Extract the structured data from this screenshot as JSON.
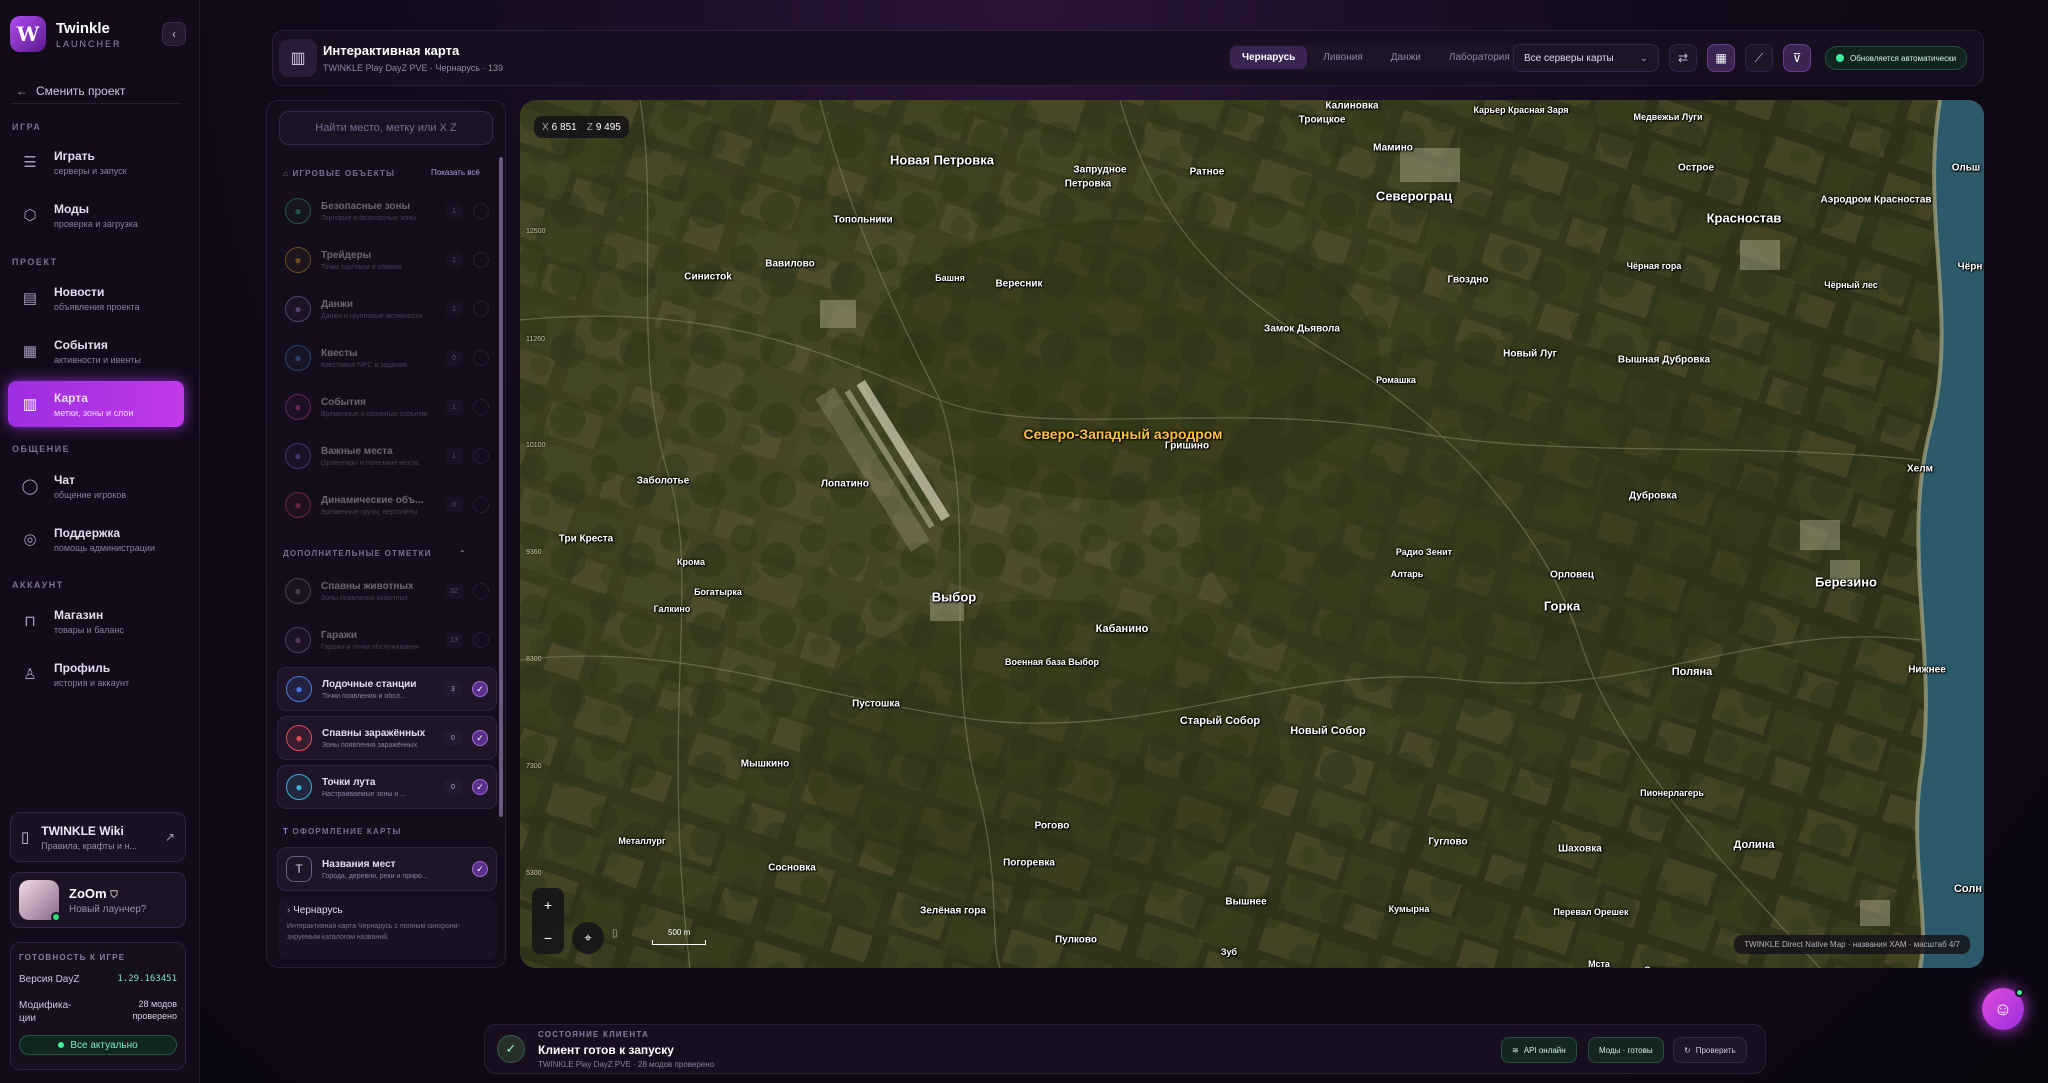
{
  "brand": {
    "title": "Twinkle",
    "subtitle": "LAUNCHER",
    "logo_letter": "W"
  },
  "sidebar": {
    "change_project": "Сменить проект",
    "sections": {
      "game": "ИГРА",
      "project": "ПРОЕКТ",
      "social": "ОБЩЕНИЕ",
      "account": "АККАУНТ"
    },
    "items": [
      {
        "title": "Играть",
        "sub": "серверы и запуск",
        "icon": "server-icon"
      },
      {
        "title": "Моды",
        "sub": "проверка и загрузка",
        "icon": "box-icon"
      },
      {
        "title": "Новости",
        "sub": "объявления проекта",
        "icon": "newspaper-icon"
      },
      {
        "title": "События",
        "sub": "активности и ивенты",
        "icon": "calendar-icon"
      },
      {
        "title": "Карта",
        "sub": "метки, зоны и слои",
        "icon": "map-icon",
        "active": true
      },
      {
        "title": "Чат",
        "sub": "общение игроков",
        "icon": "chat-icon"
      },
      {
        "title": "Поддержка",
        "sub": "помощь администрации",
        "icon": "lifebuoy-icon"
      },
      {
        "title": "Магазин",
        "sub": "товары и баланс",
        "icon": "bag-icon"
      },
      {
        "title": "Профиль",
        "sub": "история и аккаунт",
        "icon": "user-icon"
      }
    ],
    "wiki": {
      "title": "TWINKLE Wiki",
      "sub": "Правила, крафты и н..."
    },
    "user": {
      "name": "ZoOm",
      "status": "Новый лаунчер?"
    },
    "readiness": {
      "heading": "ГОТОВНОСТЬ К ИГРЕ",
      "version_label": "Версия DayZ",
      "version_value": "1.29.163451",
      "mods_label": "Модифика-\nции",
      "mods_value": "28 модов\nпроверено",
      "all_ok": "Все актуально"
    }
  },
  "header": {
    "title": "Интерактивная карта",
    "subtitle": "TWINKLE Play DayZ PVE · Чернарусь · 139",
    "tabs": [
      "Чернарусь",
      "Ливония",
      "Данжи",
      "Лаборатория"
    ],
    "server_select": "Все серверы карты",
    "auto_update": "Обновляется автоматически"
  },
  "panel": {
    "search_placeholder": "Найти место, метку или X Z",
    "group_game": "ИГРОВЫЕ ОБЪЕКТЫ",
    "show_all": "Показать всё",
    "group_extra": "ДОПОЛНИТЕЛЬНЫЕ ОТМЕТКИ",
    "group_design": "ОФОРМЛЕНИЕ КАРТЫ",
    "game_items": [
      {
        "title": "Безопасные зоны",
        "sub": "Торговые и безопасные зоны",
        "count": "1",
        "color": "#3fb08a"
      },
      {
        "title": "Трейдеры",
        "sub": "Точки торговли и обмена",
        "count": "1",
        "color": "#e0a030"
      },
      {
        "title": "Данжи",
        "sub": "Данжи и групповые активности",
        "count": "1",
        "color": "#b08ad8"
      },
      {
        "title": "Квесты",
        "sub": "Квестовые NPC и задания",
        "count": "0",
        "color": "#4a90e0"
      },
      {
        "title": "События",
        "sub": "Временные и сезонные события",
        "count": "1",
        "color": "#d04ab0"
      },
      {
        "title": "Важные места",
        "sub": "Ориентиры и полезные места",
        "count": "1",
        "color": "#7a6ad8"
      },
      {
        "title": "Динамические объ...",
        "sub": "Временные грузы, вертолёты",
        "count": "0",
        "color": "#e04a6a"
      }
    ],
    "extra_items": [
      {
        "title": "Спавны животных",
        "sub": "Зоны появления животных",
        "count": "32",
        "color": "#8a8a8a",
        "on": false
      },
      {
        "title": "Гаражи",
        "sub": "Гаражи и точки обслуживания",
        "count": "13",
        "color": "#b07ac0",
        "on": false
      },
      {
        "title": "Лодочные станции",
        "sub": "Точки появления и обсл...",
        "count": "3",
        "color": "#4a7ae0",
        "on": true
      },
      {
        "title": "Спавны заражённых",
        "sub": "Зоны появления заражённых",
        "count": "0",
        "color": "#e04a5a",
        "on": true
      },
      {
        "title": "Точки лута",
        "sub": "Настраиваемые зоны и ...",
        "count": "0",
        "color": "#3ab0d0",
        "on": true
      }
    ],
    "design_items": [
      {
        "title": "Названия мест",
        "sub": "Города, деревни, реки и приро...",
        "on": true
      }
    ],
    "footer_title": "Чернарусь",
    "footer_sub": "Интерактивная карта Чернарусь с полным синхрони-\nзируемым каталогом названий."
  },
  "map": {
    "coord_x_label": "X",
    "coord_x": "6 851",
    "coord_z_label": "Z",
    "coord_z": "9 495",
    "y_ticks": [
      "12500",
      "11260",
      "10100",
      "9360",
      "8300",
      "7300",
      "5300"
    ],
    "scale_label": "500 m",
    "attribution": "TWINKLE Direct Native Map · названия XAM · масштаб 4/7",
    "highlight": "Северо-Западный аэродром",
    "places": [
      {
        "n": "Калиновка",
        "s": "sm"
      },
      {
        "n": "Троицкое",
        "s": "sm"
      },
      {
        "n": "Карьер Красная Заря",
        "s": "xs"
      },
      {
        "n": "Медвежьи Луги",
        "s": "xs"
      },
      {
        "n": "Мамино",
        "s": "sm"
      },
      {
        "n": "Новая Петровка",
        "s": "big"
      },
      {
        "n": "Запрудное",
        "s": "sm"
      },
      {
        "n": "Петровка",
        "s": "sm"
      },
      {
        "n": "Ратное",
        "s": "sm"
      },
      {
        "n": "Северограц",
        "s": "big"
      },
      {
        "n": "Острое",
        "s": "sm"
      },
      {
        "n": "Ольш",
        "s": "sm"
      },
      {
        "n": "Аэродром Красностав",
        "s": "sm"
      },
      {
        "n": "Красностав",
        "s": "big"
      },
      {
        "n": "Топольники",
        "s": "sm"
      },
      {
        "n": "Вавилово",
        "s": "sm"
      },
      {
        "n": "Синистоk",
        "s": "sm"
      },
      {
        "n": "Башня",
        "s": "xs"
      },
      {
        "n": "Вересник",
        "s": "sm"
      },
      {
        "n": "Гвоздно",
        "s": "sm"
      },
      {
        "n": "Чёрная гора",
        "s": "xs"
      },
      {
        "n": "Чёрный лес",
        "s": "xs"
      },
      {
        "n": "Чёрн",
        "s": "sm"
      },
      {
        "n": "Замок Дьявола",
        "s": "sm"
      },
      {
        "n": "Новый Луг",
        "s": "sm"
      },
      {
        "n": "Вышная Дубровка",
        "s": "sm"
      },
      {
        "n": "Ромашка",
        "s": "xs"
      },
      {
        "n": "Гришино",
        "s": "sm"
      },
      {
        "n": "Заболотье",
        "s": "sm"
      },
      {
        "n": "Лопатино",
        "s": "sm"
      },
      {
        "n": "Хелм",
        "s": "sm"
      },
      {
        "n": "Дубровка",
        "s": "sm"
      },
      {
        "n": "Три Креста",
        "s": "sm"
      },
      {
        "n": "Радио Зенит",
        "s": "xs"
      },
      {
        "n": "Кромa",
        "s": "xs"
      },
      {
        "n": "Алтарь",
        "s": "xs"
      },
      {
        "n": "Орловец",
        "s": "sm"
      },
      {
        "n": "Березино",
        "s": "big"
      },
      {
        "n": "Богатырка",
        "s": "xs"
      },
      {
        "n": "Выбор",
        "s": "big"
      },
      {
        "n": "Галкино",
        "s": "xs"
      },
      {
        "n": "Горка",
        "s": "big"
      },
      {
        "n": "Кабанино",
        "s": "mid"
      },
      {
        "n": "Военная база Выбор",
        "s": "xs"
      },
      {
        "n": "Нижнее",
        "s": "sm"
      },
      {
        "n": "Поляна",
        "s": "mid"
      },
      {
        "n": "Пустошка",
        "s": "sm"
      },
      {
        "n": "Старый Собор",
        "s": "mid"
      },
      {
        "n": "Новый Собор",
        "s": "mid"
      },
      {
        "n": "Мышкино",
        "s": "sm"
      },
      {
        "n": "Пионерлагерь",
        "s": "xs"
      },
      {
        "n": "Рогово",
        "s": "sm"
      },
      {
        "n": "Металлург",
        "s": "xs"
      },
      {
        "n": "Гуглово",
        "s": "sm"
      },
      {
        "n": "Шаховка",
        "s": "sm"
      },
      {
        "n": "Долина",
        "s": "mid"
      },
      {
        "n": "Сосновка",
        "s": "sm"
      },
      {
        "n": "Погоревка",
        "s": "sm"
      },
      {
        "n": "Зелёная гора",
        "s": "sm"
      },
      {
        "n": "Вышнее",
        "s": "sm"
      },
      {
        "n": "Кумырна",
        "s": "xs"
      },
      {
        "n": "Перевал Орешек",
        "s": "xs"
      },
      {
        "n": "Солн",
        "s": "mid"
      },
      {
        "n": "Пулково",
        "s": "sm"
      },
      {
        "n": "Зуб",
        "s": "xs"
      },
      {
        "n": "Мста",
        "s": "xs"
      },
      {
        "n": "Старое",
        "s": "xs"
      }
    ]
  },
  "status": {
    "heading": "СОСТОЯНИЕ КЛИЕНТА",
    "title": "Клиент готов к запуску",
    "sub": "TWINKLE Play DayZ PVE · 28 модов проверено",
    "api": "API онлайн",
    "mods": "Моды · готовы",
    "check": "Проверить"
  }
}
